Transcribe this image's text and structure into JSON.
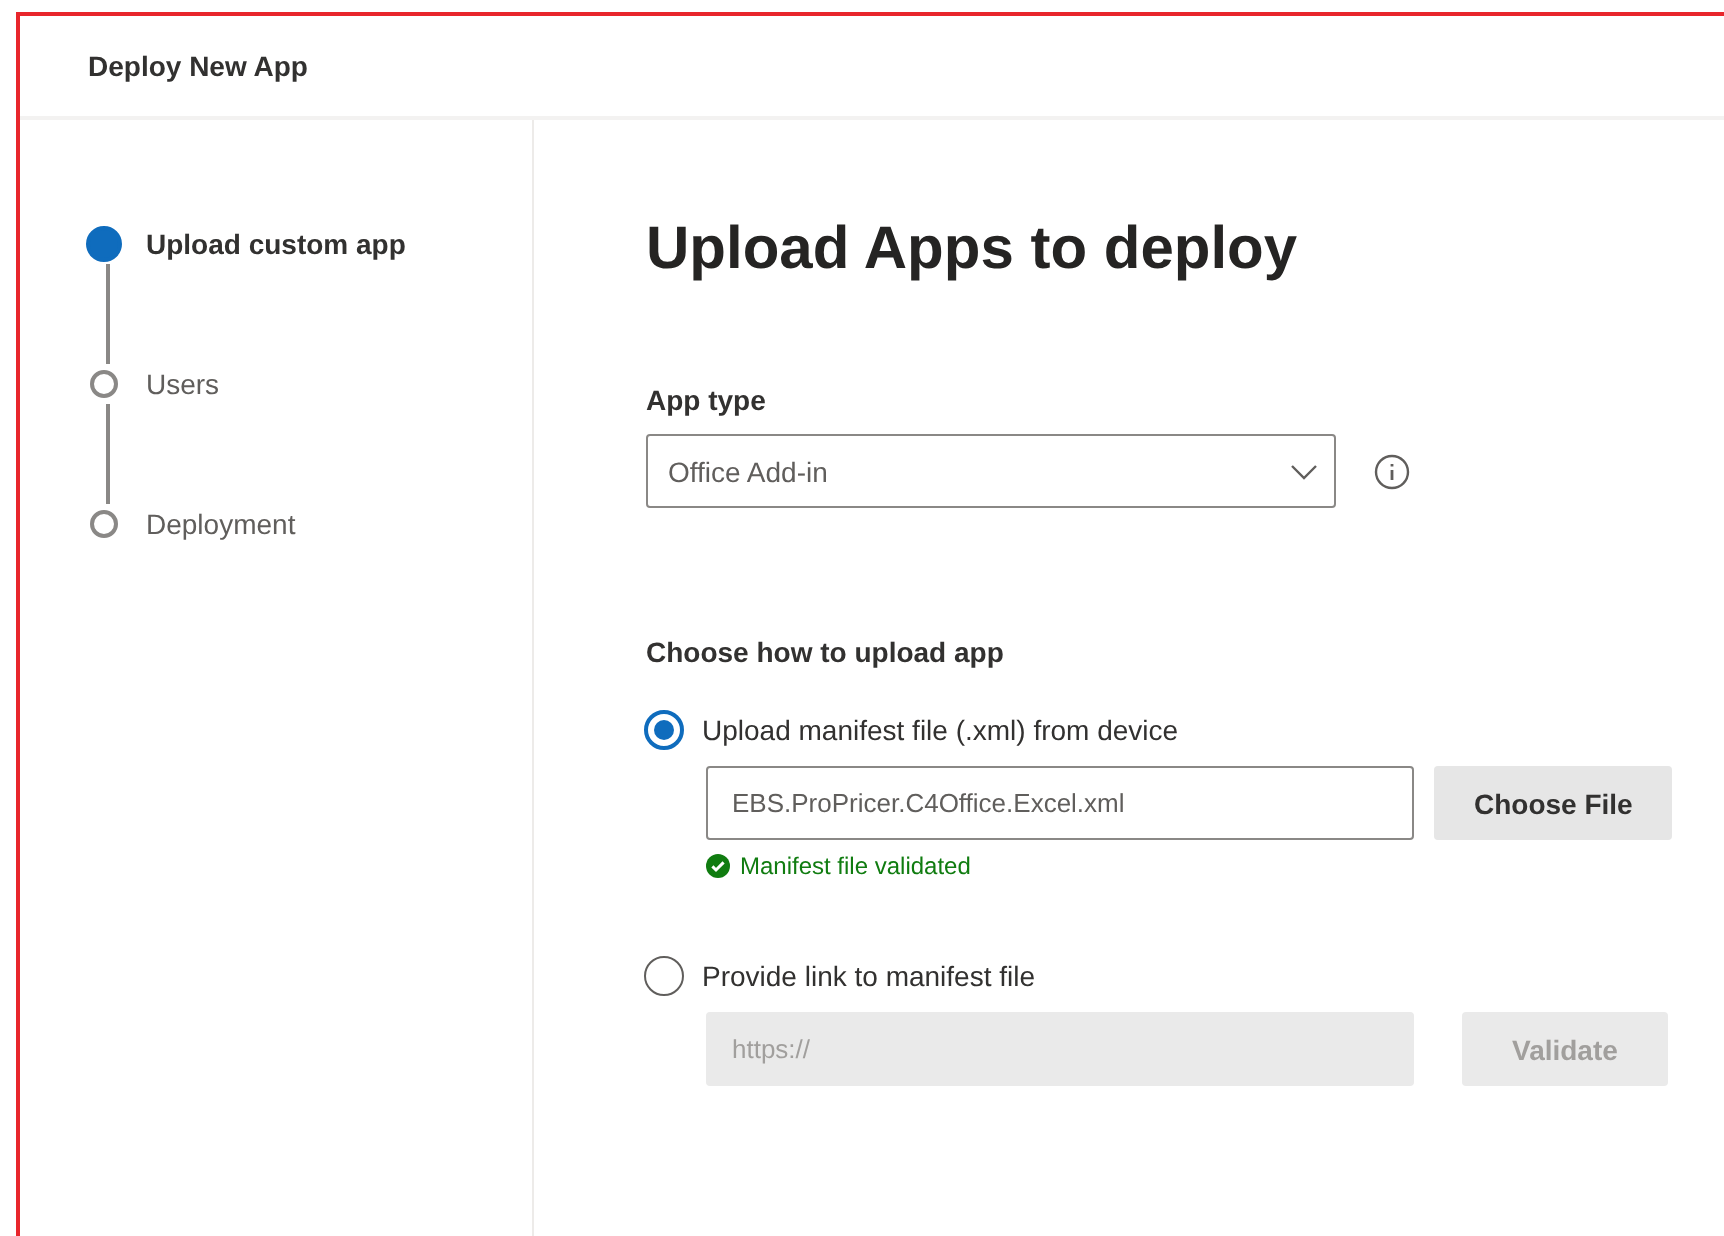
{
  "window": {
    "title": "Deploy New App"
  },
  "steps": [
    {
      "label": "Upload custom app",
      "selected": true
    },
    {
      "label": "Users",
      "selected": false
    },
    {
      "label": "Deployment",
      "selected": false
    }
  ],
  "heading": "Upload Apps to deploy",
  "app_type": {
    "label": "App type",
    "value": "Office Add-in"
  },
  "upload_section": {
    "title": "Choose how to upload app"
  },
  "options": [
    {
      "label": "Upload manifest file (.xml) from device",
      "selected": true,
      "disabled": false,
      "value": "EBS.ProPricer.C4Office.Excel.xml",
      "button": "Choose File",
      "status": "Manifest file validated"
    },
    {
      "label": "Provide link to manifest file",
      "selected": false,
      "disabled": true,
      "placeholder": "https://",
      "button": "Validate"
    }
  ]
}
